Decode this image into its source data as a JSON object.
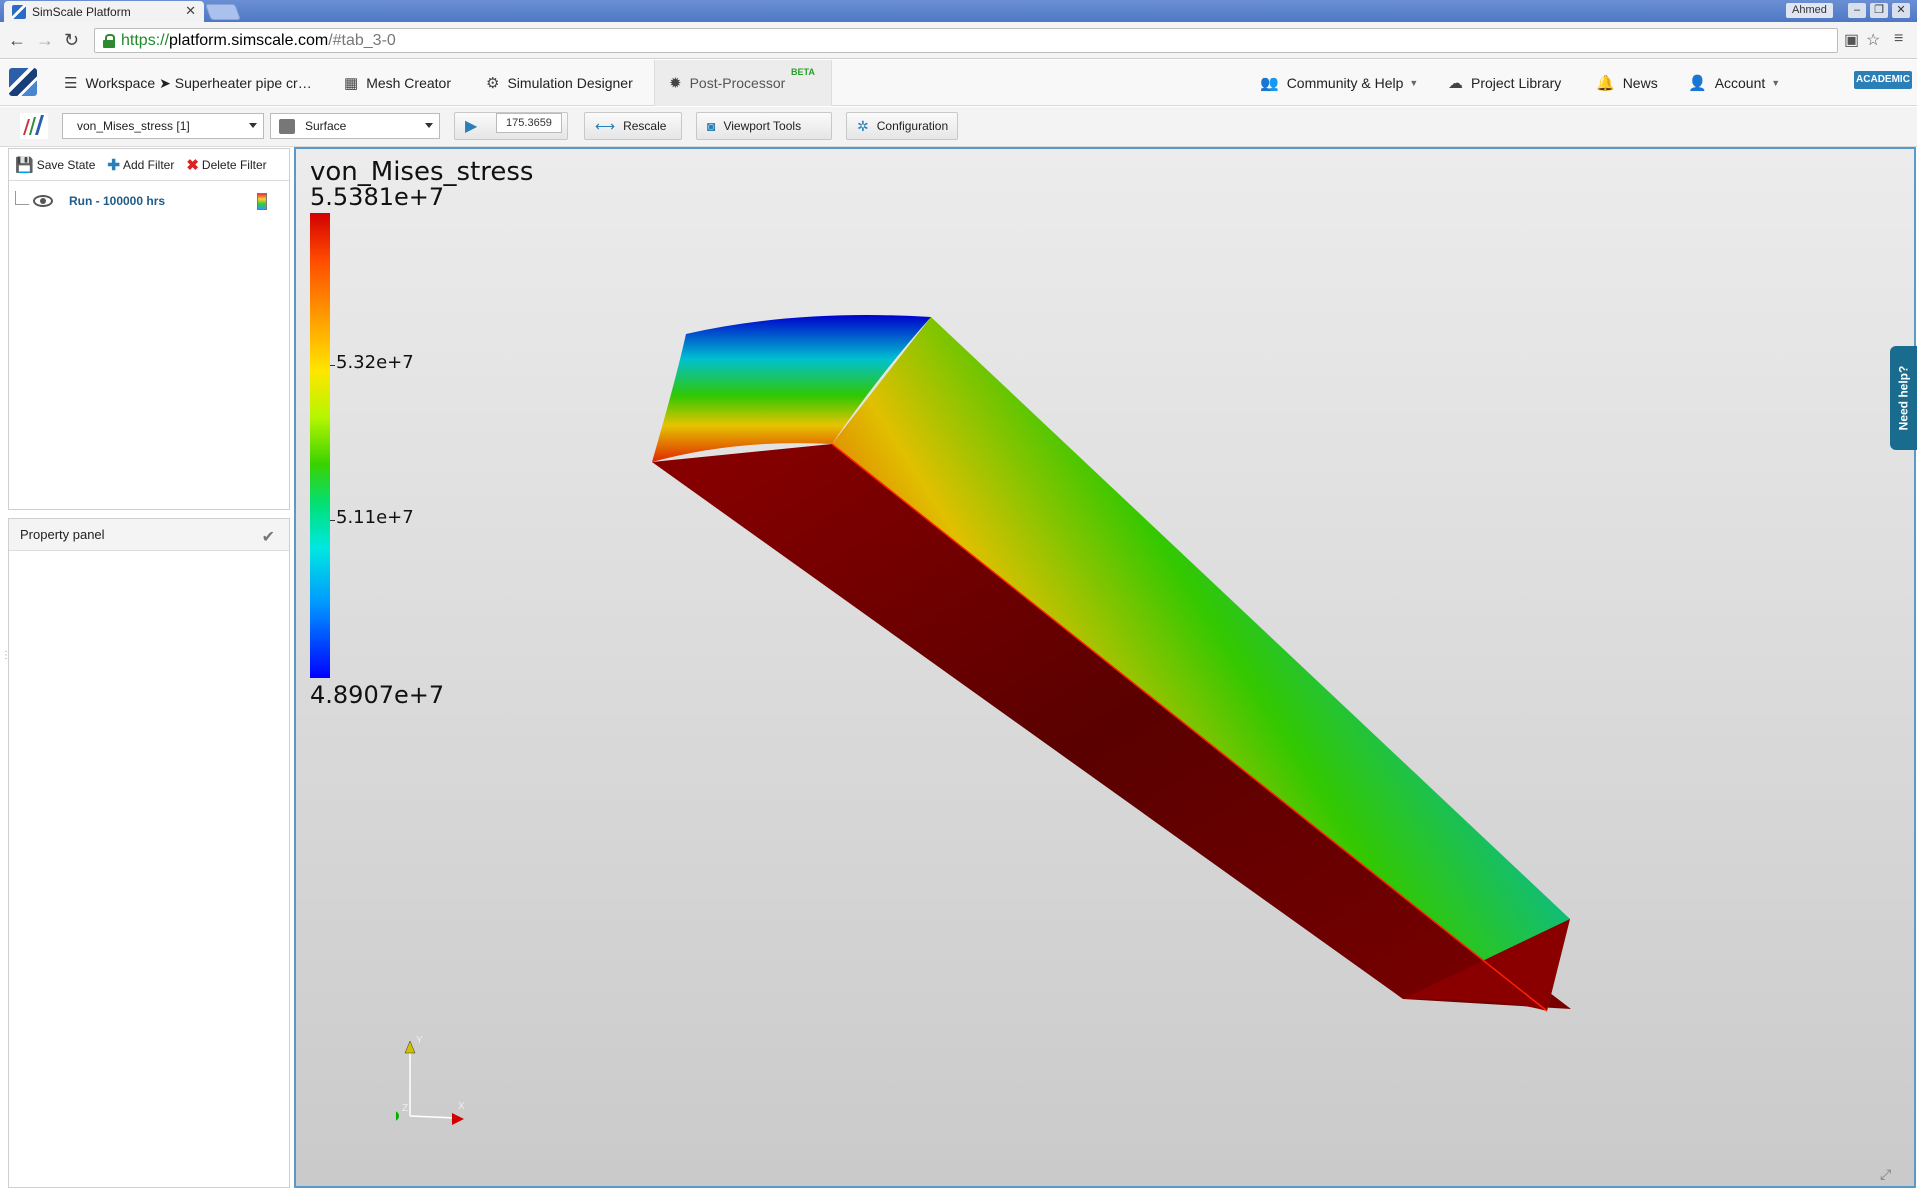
{
  "browser": {
    "tab_title": "SimScale Platform",
    "tab_close": "✕",
    "user": "Ahmed",
    "url_scheme": "https://",
    "url_host": "platform.simscale.com",
    "url_path": "/#tab_3-0"
  },
  "nav": {
    "workspace": "Workspace ➤ Superheater pipe cr…",
    "mesh_creator": "Mesh Creator",
    "simulation_designer": "Simulation Designer",
    "post_processor": "Post-Processor",
    "beta": "BETA",
    "community": "Community & Help",
    "project_library": "Project Library",
    "news": "News",
    "account": "Account",
    "badge": "ACADEMIC"
  },
  "toolbar": {
    "field_select": "von_Mises_stress [1]",
    "representation_select": "Surface",
    "time_value": "175.3659",
    "rescale": "Rescale",
    "viewport_tools": "Viewport Tools",
    "configuration": "Configuration"
  },
  "pipeline": {
    "save_state": "Save State",
    "add_filter": "Add Filter",
    "delete_filter": "Delete Filter",
    "items": [
      {
        "label": "Run - 100000 hrs"
      }
    ]
  },
  "property_panel": {
    "title": "Property panel"
  },
  "viewport": {
    "legend": {
      "title": "von_Mises_stress",
      "max": "5.5381e+7",
      "min": "4.8907e+7",
      "ticks": [
        "5.32e+7",
        "5.11e+7"
      ]
    },
    "axes_labels": {
      "x": "X",
      "y": "Y",
      "z": "Z"
    },
    "help_tab": "Need help?",
    "colors": {
      "max_color": "#d20000",
      "min_color": "#0000ff",
      "accent": "#5a9ac9"
    }
  },
  "icons": {
    "back": "back-arrow-icon",
    "forward": "forward-arrow-icon",
    "reload": "reload-icon",
    "lock": "lock-icon",
    "star": "star-icon",
    "menu": "hamburger-menu-icon"
  }
}
